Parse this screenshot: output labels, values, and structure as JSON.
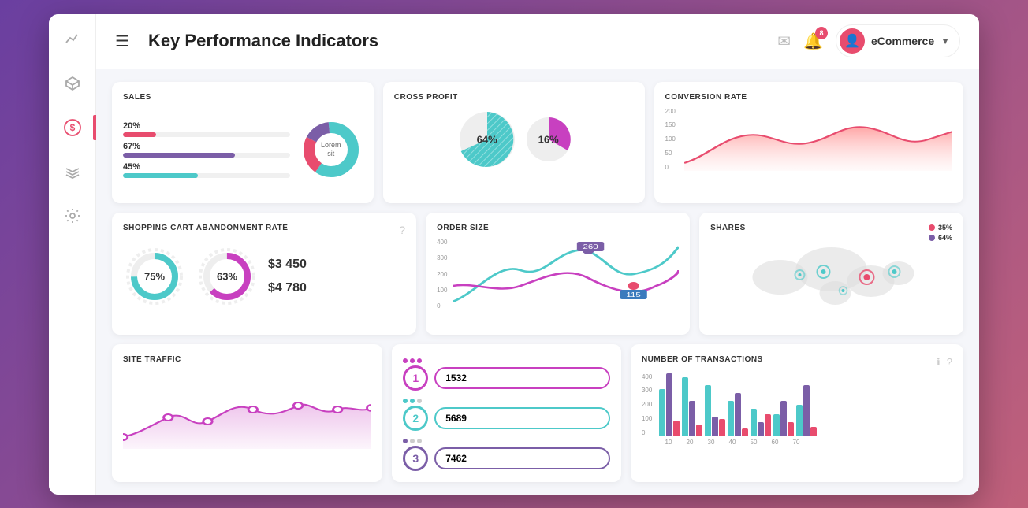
{
  "app": {
    "title": "Key Performance Indicators",
    "user": {
      "name": "eCommerce",
      "avatar_icon": "👤"
    },
    "bell_badge": "8",
    "hamburger_label": "☰"
  },
  "sidebar": {
    "items": [
      {
        "id": "chart",
        "icon": "📈",
        "active": false
      },
      {
        "id": "cube",
        "icon": "📦",
        "active": false
      },
      {
        "id": "dollar",
        "icon": "💲",
        "active": true
      },
      {
        "id": "layers",
        "icon": "🗂️",
        "active": false
      },
      {
        "id": "settings",
        "icon": "⚙️",
        "active": false
      }
    ]
  },
  "widgets": {
    "sales": {
      "title": "SALES",
      "bars": [
        {
          "label": "20%",
          "value": 20,
          "color": "#e84c6e"
        },
        {
          "label": "67%",
          "value": 67,
          "color": "#7b5ea7"
        },
        {
          "label": "45%",
          "value": 45,
          "color": "#4dc9c9"
        }
      ],
      "donut_center": "Lorem\nsit"
    },
    "cross_profit": {
      "title": "CROSS PROFIT",
      "value1": "64%",
      "value2": "16%"
    },
    "conversion_rate": {
      "title": "CONVERSION RATE",
      "y_labels": [
        "200",
        "150",
        "100",
        "50",
        "0"
      ]
    },
    "shopping_cart": {
      "title": "SHOPPING CART ABANDONMENT RATE",
      "circle1_value": "75%",
      "circle2_value": "63%",
      "value1": "$3 450",
      "value2": "$4 780"
    },
    "order_size": {
      "title": "ORDER SIZE",
      "y_labels": [
        "400",
        "300",
        "200",
        "100",
        "0"
      ],
      "point1": "260",
      "point2": "115"
    },
    "shares": {
      "title": "SHARES",
      "legend": [
        {
          "label": "35%",
          "color": "#e84c6e"
        },
        {
          "label": "64%",
          "color": "#7b5ea7"
        }
      ]
    },
    "site_traffic": {
      "title": "SITE TRAFFIC"
    },
    "rank_list": {
      "items": [
        {
          "rank": "1",
          "value": "1532",
          "color": "#c840c0",
          "dots": [
            "#c840c0",
            "#c840c0",
            "#c840c0"
          ]
        },
        {
          "rank": "2",
          "value": "5689",
          "color": "#4dc9c9",
          "dots": [
            "#4dc9c9",
            "#4dc9c9",
            "#999"
          ]
        },
        {
          "rank": "3",
          "value": "7462",
          "color": "#7b5ea7",
          "dots": [
            "#7b5ea7",
            "#999",
            "#999"
          ]
        }
      ]
    },
    "transactions": {
      "title": "NUMBER OF TRANSACTIONS",
      "y_labels": [
        "400",
        "300",
        "200",
        "100",
        "0"
      ],
      "x_labels": [
        "10",
        "20",
        "30",
        "40",
        "50",
        "60",
        "70"
      ],
      "bars": [
        {
          "heights": [
            60,
            80,
            20
          ],
          "colors": [
            "#4dc9c9",
            "#7b5ea7",
            "#e84c6e"
          ]
        },
        {
          "heights": [
            90,
            50,
            15
          ],
          "colors": [
            "#4dc9c9",
            "#7b5ea7",
            "#e84c6e"
          ]
        },
        {
          "heights": [
            70,
            30,
            25
          ],
          "colors": [
            "#4dc9c9",
            "#7b5ea7",
            "#e84c6e"
          ]
        },
        {
          "heights": [
            50,
            60,
            10
          ],
          "colors": [
            "#4dc9c9",
            "#7b5ea7",
            "#e84c6e"
          ]
        },
        {
          "heights": [
            40,
            20,
            30
          ],
          "colors": [
            "#4dc9c9",
            "#7b5ea7",
            "#e84c6e"
          ]
        },
        {
          "heights": [
            30,
            50,
            20
          ],
          "colors": [
            "#4dc9c9",
            "#7b5ea7",
            "#e84c6e"
          ]
        },
        {
          "heights": [
            45,
            70,
            15
          ],
          "colors": [
            "#4dc9c9",
            "#7b5ea7",
            "#e84c6e"
          ]
        }
      ]
    }
  }
}
